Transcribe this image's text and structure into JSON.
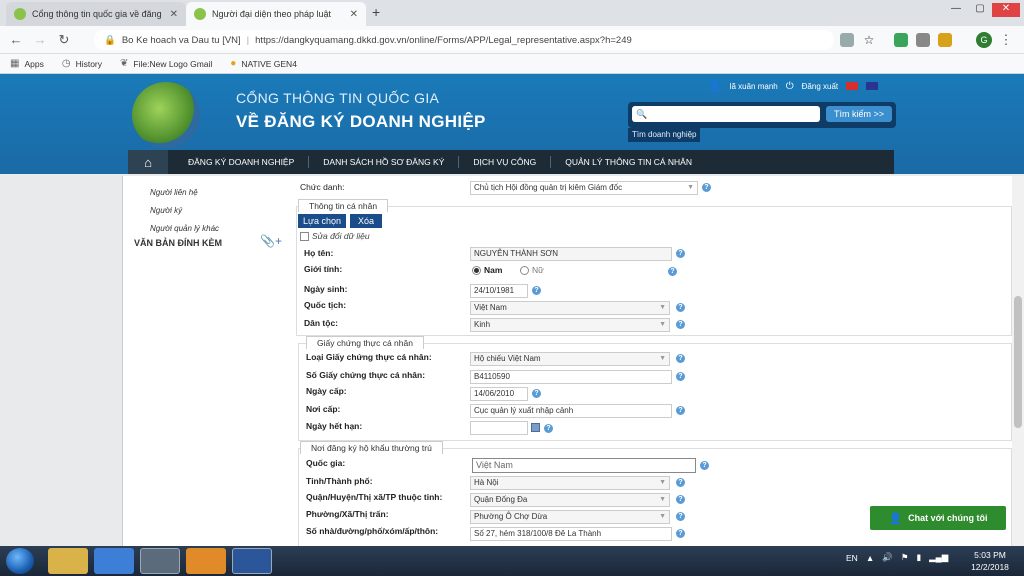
{
  "browser": {
    "tabs": [
      {
        "title": "Cổng thông tin quốc gia về đăng"
      },
      {
        "title": "Người đại diện theo pháp luật"
      }
    ],
    "site_label": "Bo Ke hoach va Dau tu [VN]",
    "url": "https://dangkyquamang.dkkd.gov.vn/online/Forms/APP/Legal_representative.aspx?h=249",
    "bookmarks": [
      {
        "label": "Apps",
        "icon": "apps-grid-icon"
      },
      {
        "label": "History",
        "icon": "history-icon"
      },
      {
        "label": "File:New Logo Gmail",
        "icon": "file-icon"
      },
      {
        "label": "NATIVE GEN4",
        "icon": "native-icon"
      }
    ],
    "avatar_letter": "G"
  },
  "site": {
    "title_line1": "CỔNG THÔNG TIN QUỐC GIA",
    "title_line2": "VỀ ĐĂNG KÝ DOANH NGHIỆP",
    "user_name": "lã xuân mạnh",
    "logout_label": "Đăng xuất",
    "search_placeholder": "",
    "search_button": "Tìm kiếm >>",
    "search_hint": "Tìm doanh nghiệp",
    "menu": [
      "ĐĂNG KÝ DOANH NGHIỆP",
      "DANH SÁCH HỒ SƠ ĐĂNG KÝ",
      "DỊCH VỤ CÔNG",
      "QUẢN LÝ THÔNG TIN CÁ NHÂN"
    ]
  },
  "sidebar": {
    "items": [
      "Người liên hệ",
      "Người ký",
      "Người quản lý khác"
    ],
    "attachments_label": "VĂN BẢN ĐÍNH KÈM"
  },
  "form": {
    "chuc_danh_label": "Chức danh:",
    "chuc_danh_value": "Chủ tịch Hội đồng quản trị kiêm Giám đốc",
    "personal_section": "Thông tin cá nhân",
    "btn_select": "Lựa chọn",
    "btn_delete": "Xóa",
    "edit_checkbox": "Sửa đổi dữ liệu",
    "ho_ten_label": "Họ tên:",
    "ho_ten_value": "NGUYỄN THÀNH SƠN",
    "gioi_tinh_label": "Giới tính:",
    "gender_male": "Nam",
    "gender_female": "Nữ",
    "ngay_sinh_label": "Ngày sinh:",
    "ngay_sinh_value": "24/10/1981",
    "quoc_tich_label": "Quốc tịch:",
    "quoc_tich_value": "Việt Nam",
    "dan_toc_label": "Dân tộc:",
    "dan_toc_value": "Kinh",
    "id_section": "Giấy chứng thực cá nhân",
    "id_type_label": "Loại Giấy chứng thực cá nhân:",
    "id_type_value": "Hộ chiếu Việt Nam",
    "id_number_label": "Số Giấy chứng thực cá nhân:",
    "id_number_value": "B4110590",
    "issue_date_label": "Ngày cấp:",
    "issue_date_value": "14/06/2010",
    "issue_place_label": "Nơi cấp:",
    "issue_place_value": "Cục quản lý xuất nhập cảnh",
    "expiry_label": "Ngày hết hạn:",
    "expiry_value": "",
    "address_section": "Nơi đăng ký hộ khẩu thường trú",
    "country_label": "Quốc gia:",
    "country_value": "Việt Nam",
    "province_label": "Tỉnh/Thành phố:",
    "province_value": "Hà Nội",
    "district_label": "Quận/Huyện/Thị xã/TP thuộc tỉnh:",
    "district_value": "Quận Đống Đa",
    "ward_label": "Phường/Xã/Thị trấn:",
    "ward_value": "Phường Ô Chợ Dừa",
    "street_label": "Số nhà/đường/phố/xóm/ấp/thôn:",
    "street_value": "Số 27, hẻm 318/100/8 Đê La Thành"
  },
  "chat_label": "Chat với chúng tôi",
  "taskbar": {
    "lang": "EN",
    "time": "5:03 PM",
    "date": "12/2/2018"
  },
  "colors": {
    "header_blue": "#1a6aa6",
    "menu_dark": "#1c2b36",
    "button_blue": "#1a4d8a",
    "chat_green": "#2e8b2e"
  }
}
